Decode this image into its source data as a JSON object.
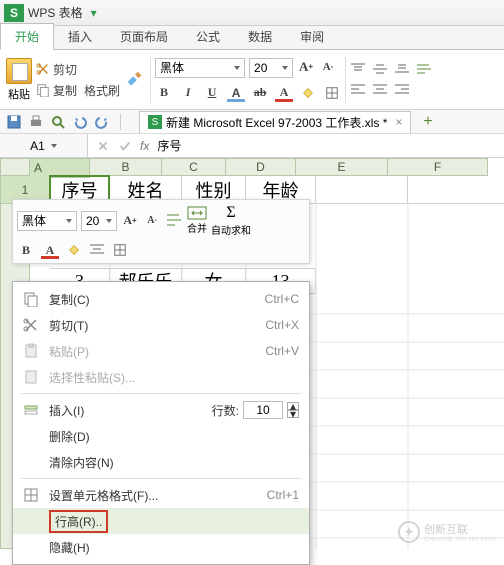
{
  "app": {
    "logo": "S",
    "name": "WPS 表格",
    "menu_dd": "▾"
  },
  "tabs": {
    "start": "开始",
    "insert": "插入",
    "layout": "页面布局",
    "formula": "公式",
    "data": "数据",
    "review": "审阅"
  },
  "ribbon": {
    "paste": "粘贴",
    "cut": "剪切",
    "copy": "复制",
    "fmtpainter": "格式刷",
    "font_name": "黑体",
    "font_size": "20",
    "b": "B",
    "i": "I",
    "u": "U",
    "ab": "A",
    "strike": "S"
  },
  "doc": {
    "icon": "S",
    "title": "新建 Microsoft Excel 97-2003 工作表.xls *",
    "close": "×",
    "add": "+"
  },
  "namebox": {
    "ref": "A1",
    "fx": "fx",
    "val": "序号"
  },
  "cols": [
    "A",
    "B",
    "C",
    "D",
    "E",
    "F"
  ],
  "rownums": [
    "1"
  ],
  "headers": {
    "a": "序号",
    "b": "姓名",
    "c": "性别",
    "d": "年龄"
  },
  "row3": {
    "a": "3",
    "b": "郝乐乐",
    "c": "女",
    "d": "13"
  },
  "mini": {
    "font": "黑体",
    "size": "20",
    "merge": "合并",
    "autosum": "自动求和"
  },
  "menu": {
    "copy": "复制(C)",
    "copy_k": "Ctrl+C",
    "cut": "剪切(T)",
    "cut_k": "Ctrl+X",
    "paste": "粘贴(P)",
    "paste_k": "Ctrl+V",
    "pastesp": "选择性粘贴(S)...",
    "insert": "插入(I)",
    "rows_lbl": "行数:",
    "rows_val": "10",
    "delete": "删除(D)",
    "clear": "清除内容(N)",
    "formatcells": "设置单元格格式(F)...",
    "formatcells_k": "Ctrl+1",
    "rowheight": "行高(R)..",
    "hide": "隐藏(H)"
  },
  "watermark": {
    "t1": "创新互联",
    "t2": "CHUANG XIN HU LIAN"
  }
}
